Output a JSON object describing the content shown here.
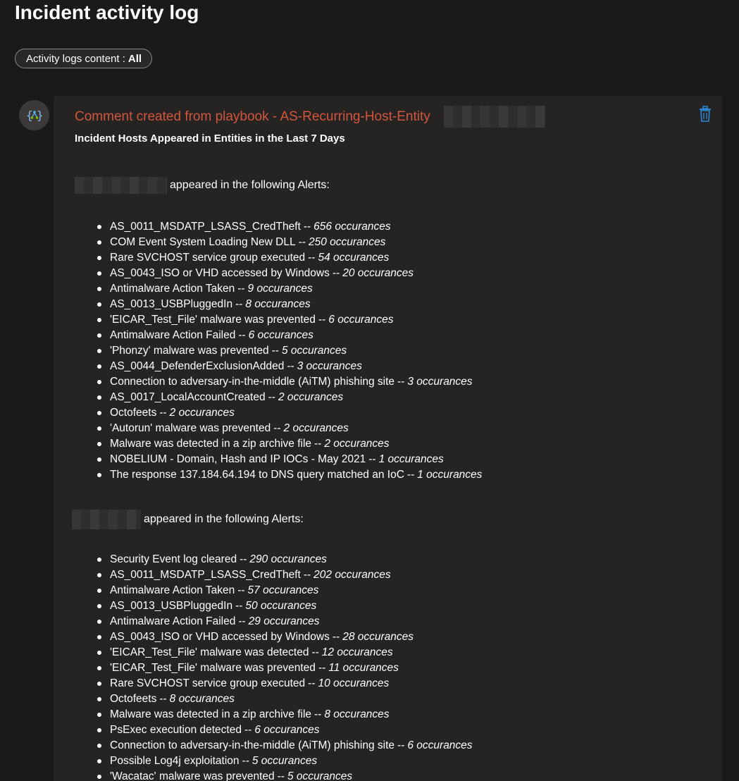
{
  "page": {
    "title": "Incident activity log"
  },
  "filter": {
    "label": "Activity logs content :",
    "value": "All"
  },
  "entry": {
    "avatar_icon": "playbook-logic-app-icon",
    "title": "Comment created from playbook - AS-Recurring-Host-Entity",
    "delete_icon": "trash-icon",
    "title_color": "#d2553d",
    "accent_color": "#2b88d8",
    "subtitle": "Incident Hosts Appeared in Entities in the Last 7 Days",
    "hosts": [
      {
        "suffix": "appeared in the following Alerts:",
        "alerts": [
          {
            "name": "AS_0011_MSDATP_LSASS_CredTheft",
            "sep": "--",
            "count": "656 occurances"
          },
          {
            "name": "COM Event System Loading New DLL",
            "sep": "--",
            "count": "250 occurances"
          },
          {
            "name": "Rare SVCHOST service group executed",
            "sep": "--",
            "count": "54 occurances"
          },
          {
            "name": "AS_0043_ISO or VHD accessed by Windows",
            "sep": "--",
            "count": "20 occurances"
          },
          {
            "name": "Antimalware Action Taken",
            "sep": "--",
            "count": "9 occurances"
          },
          {
            "name": "AS_0013_USBPluggedIn",
            "sep": "--",
            "count": "8 occurances"
          },
          {
            "name": "'EICAR_Test_File' malware was prevented",
            "sep": "--",
            "count": "6 occurances"
          },
          {
            "name": "Antimalware Action Failed",
            "sep": "--",
            "count": "6 occurances"
          },
          {
            "name": "'Phonzy' malware was prevented",
            "sep": "--",
            "count": "5 occurances"
          },
          {
            "name": "AS_0044_DefenderExclusionAdded",
            "sep": "--",
            "count": "3 occurances"
          },
          {
            "name": "Connection to adversary-in-the-middle (AiTM) phishing site",
            "sep": "--",
            "count": "3 occurances"
          },
          {
            "name": "AS_0017_LocalAccountCreated",
            "sep": "--",
            "count": "2 occurances"
          },
          {
            "name": "Octofeets",
            "sep": "--",
            "count": "2 occurances"
          },
          {
            "name": "'Autorun' malware was prevented",
            "sep": "--",
            "count": "2 occurances"
          },
          {
            "name": "Malware was detected in a zip archive file",
            "sep": "--",
            "count": "2 occurances"
          },
          {
            "name": "NOBELIUM - Domain, Hash and IP IOCs - May 2021",
            "sep": "--",
            "count": "1 occurances"
          },
          {
            "name": "The response 137.184.64.194 to DNS query matched an IoC",
            "sep": "--",
            "count": "1 occurances"
          }
        ]
      },
      {
        "suffix": "appeared in the following Alerts:",
        "alerts": [
          {
            "name": "Security Event log cleared",
            "sep": "--",
            "count": "290 occurances"
          },
          {
            "name": "AS_0011_MSDATP_LSASS_CredTheft",
            "sep": "--",
            "count": "202 occurances"
          },
          {
            "name": "Antimalware Action Taken",
            "sep": "--",
            "count": "57 occurances"
          },
          {
            "name": "AS_0013_USBPluggedIn",
            "sep": "--",
            "count": "50 occurances"
          },
          {
            "name": "Antimalware Action Failed",
            "sep": "--",
            "count": "29 occurances"
          },
          {
            "name": "AS_0043_ISO or VHD accessed by Windows",
            "sep": "--",
            "count": "28 occurances"
          },
          {
            "name": "'EICAR_Test_File' malware was detected",
            "sep": "--",
            "count": "12 occurances"
          },
          {
            "name": "'EICAR_Test_File' malware was prevented",
            "sep": "--",
            "count": "11 occurances"
          },
          {
            "name": "Rare SVCHOST service group executed",
            "sep": "--",
            "count": "10 occurances"
          },
          {
            "name": "Octofeets",
            "sep": "--",
            "count": "8 occurances"
          },
          {
            "name": "Malware was detected in a zip archive file",
            "sep": "--",
            "count": "8 occurances"
          },
          {
            "name": "PsExec execution detected",
            "sep": "--",
            "count": "6 occurances"
          },
          {
            "name": "Connection to adversary-in-the-middle (AiTM) phishing site",
            "sep": "--",
            "count": "6 occurances"
          },
          {
            "name": "Possible Log4j exploitation",
            "sep": "--",
            "count": "5 occurances"
          },
          {
            "name": "'Wacatac' malware was prevented",
            "sep": "--",
            "count": "5 occurances"
          }
        ]
      }
    ]
  }
}
